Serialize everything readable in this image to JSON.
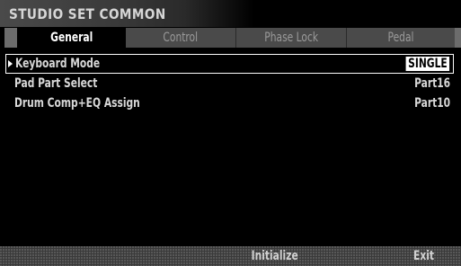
{
  "header": {
    "title": "STUDIO SET COMMON"
  },
  "tabs": [
    {
      "label": "General",
      "active": true
    },
    {
      "label": "Control",
      "active": false
    },
    {
      "label": "Phase Lock",
      "active": false
    },
    {
      "label": "Pedal",
      "active": false
    }
  ],
  "params": [
    {
      "name": "Keyboard Mode",
      "value": "SINGLE",
      "selected": true
    },
    {
      "name": "Pad Part Select",
      "value": "Part16",
      "selected": false
    },
    {
      "name": "Drum Comp+EQ Assign",
      "value": "Part10",
      "selected": false
    }
  ],
  "footer": {
    "initialize_label": "Initialize",
    "exit_label": "Exit"
  },
  "colors": {
    "background": "#000000",
    "tab_inactive": "#4a4a4a",
    "tab_active": "#000000",
    "text": "#d8d8d8",
    "highlight": "#ffffff"
  }
}
